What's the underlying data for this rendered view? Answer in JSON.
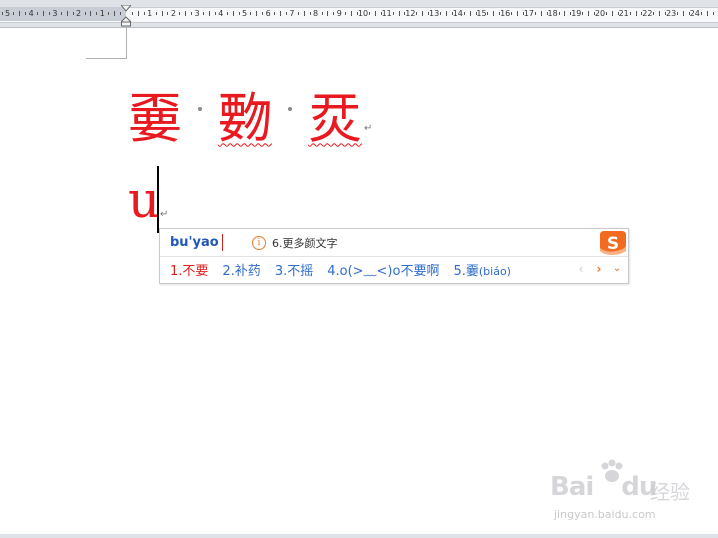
{
  "ruler": {
    "numbers": [
      "5",
      "4",
      "3",
      "2",
      "1",
      "1",
      "2",
      "3",
      "4",
      "5",
      "6",
      "7",
      "8",
      "9",
      "10",
      "11",
      "12",
      "13",
      "14",
      "15",
      "16",
      "17",
      "18",
      "19",
      "20",
      "21",
      "22",
      "23",
      "24"
    ]
  },
  "document": {
    "line1_chars": [
      "嫑",
      "覅",
      "烎"
    ],
    "line2_text": "u"
  },
  "ime": {
    "pinyin": "bu'yao",
    "hint_text": "6.更多颜文字",
    "candidates": [
      {
        "label": "1.不要"
      },
      {
        "label": "2.补药"
      },
      {
        "label": "3.不摇"
      },
      {
        "label": "4.o(>﹏<)o不要啊"
      },
      {
        "label": "5.嫑",
        "reading": "(biáo)"
      }
    ],
    "accent_color": "#2f6ccf",
    "selected_color": "#e02020"
  },
  "watermark": {
    "brand": "Bai",
    "brand2": "du",
    "zh": "经验",
    "url": "jingyan.baidu.com"
  }
}
